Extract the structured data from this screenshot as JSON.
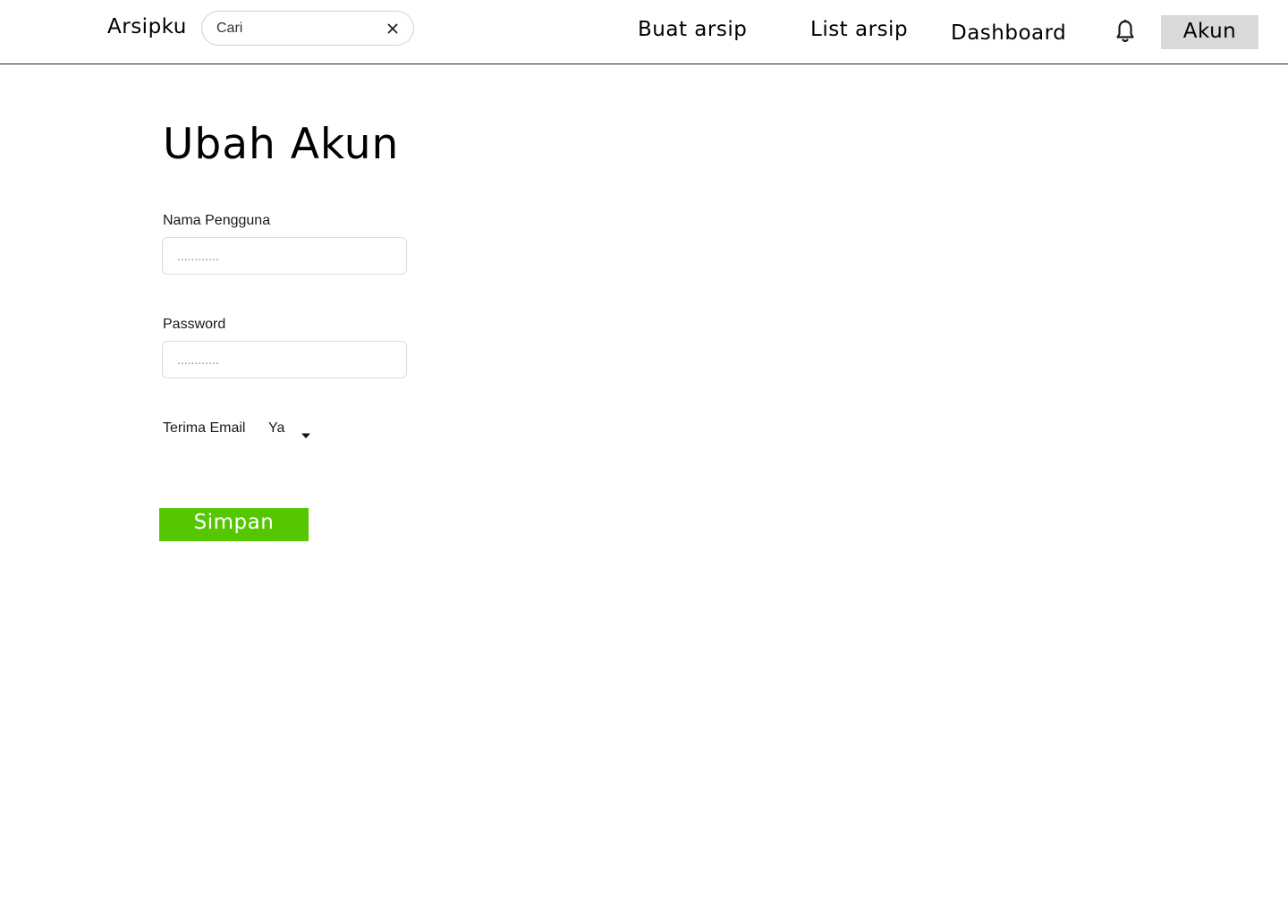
{
  "header": {
    "brand": "Arsipku",
    "search": {
      "value": "Cari",
      "clear_icon": "close-icon"
    },
    "nav": {
      "buat_arsip": "Buat arsip",
      "list_arsip": "List arsip",
      "dashboard": "Dashboard"
    },
    "notification_icon": "bell-icon",
    "account_button": "Akun"
  },
  "main": {
    "title": "Ubah Akun",
    "form": {
      "username": {
        "label": "Nama Pengguna",
        "placeholder": "............",
        "value": ""
      },
      "password": {
        "label": "Password",
        "placeholder": "............",
        "value": ""
      },
      "receive_email": {
        "label": "Terima Email",
        "selected": "Ya",
        "caret_icon": "chevron-down-icon"
      },
      "save_button": "Simpan"
    }
  },
  "colors": {
    "save_button_bg": "#55c700",
    "account_button_bg": "#d9d9d9",
    "header_border": "#222222"
  }
}
